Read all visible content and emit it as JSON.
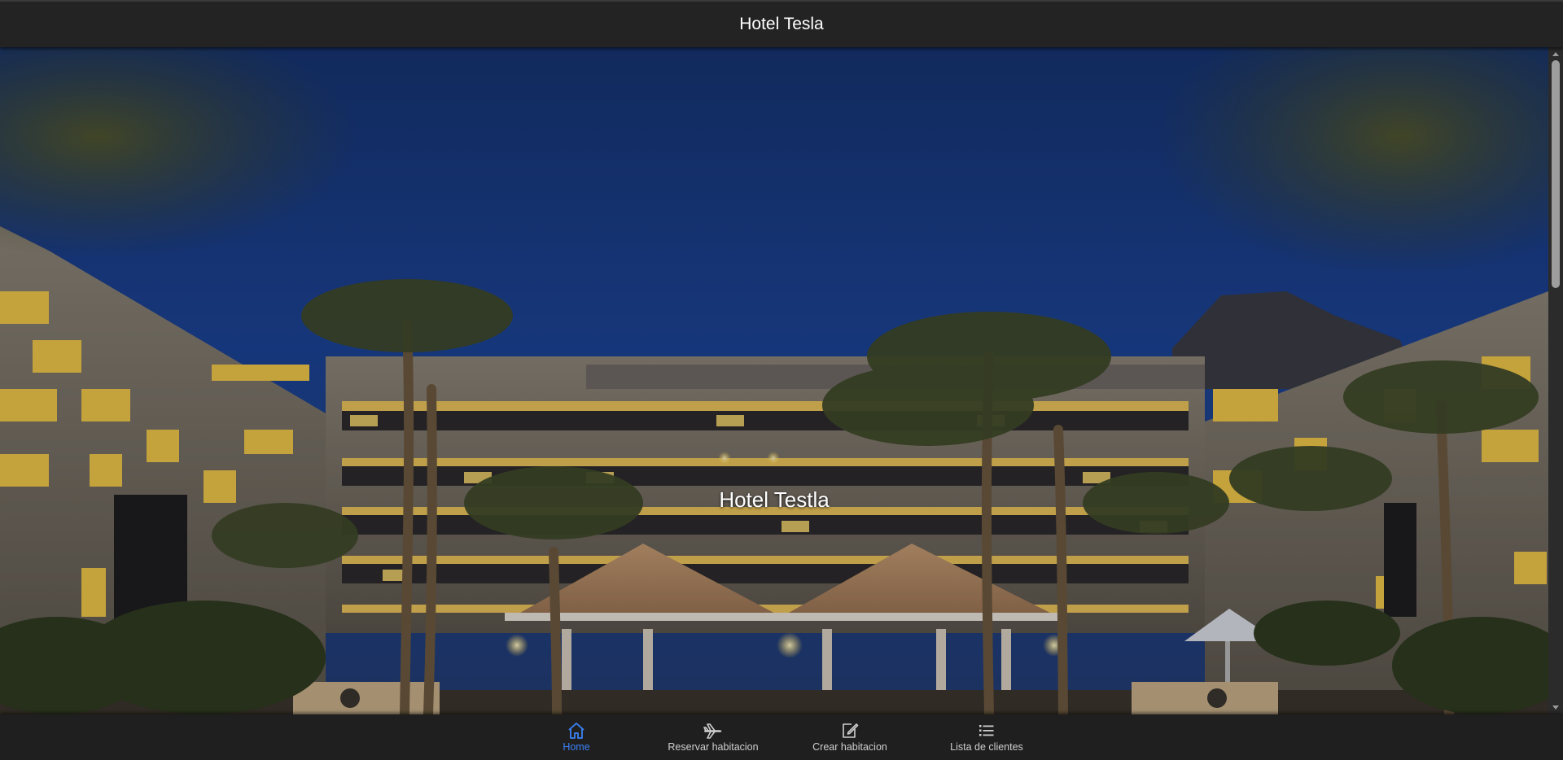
{
  "header": {
    "title": "Hotel Tesla"
  },
  "hero": {
    "title": "Hotel Testla"
  },
  "bottom_nav": {
    "items": [
      {
        "label": "Home",
        "icon": "home-icon",
        "active": true
      },
      {
        "label": "Reservar habitacion",
        "icon": "airplane-icon",
        "active": false
      },
      {
        "label": "Crear habitacion",
        "icon": "edit-icon",
        "active": false
      },
      {
        "label": "Lista de clientes",
        "icon": "list-icon",
        "active": false
      }
    ]
  },
  "colors": {
    "active": "#3b82f6",
    "bar": "#232323",
    "sky": "#1b3d8a"
  }
}
